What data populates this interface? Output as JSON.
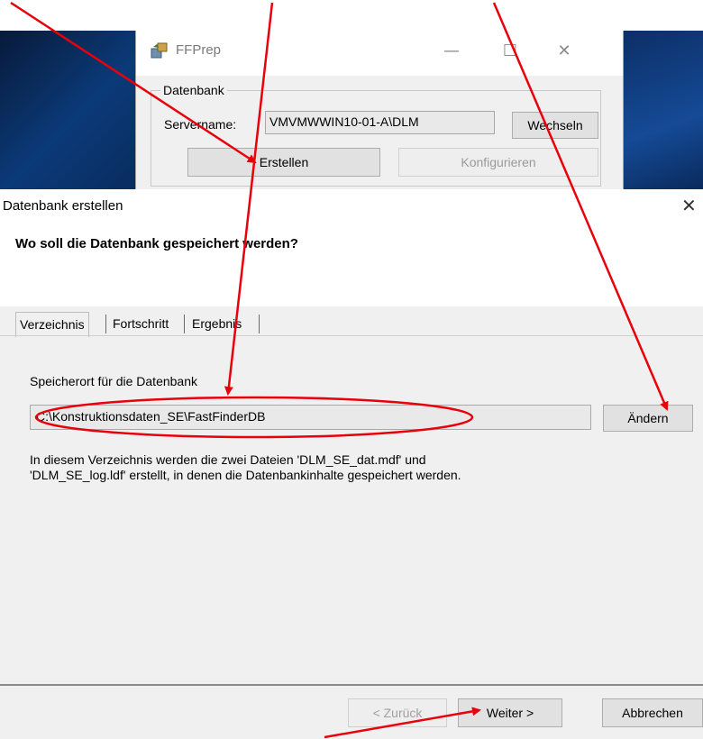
{
  "ffprep": {
    "title": "FFPrep",
    "minimize": "—",
    "maximize": "☐",
    "close": "✕",
    "group_label": "Datenbank",
    "servername_label": "Servername:",
    "servername_value": "VMVMWWIN10-01-A\\DLM",
    "wechseln_label": "Wechseln",
    "erstellen_label": "Erstellen",
    "konfigurieren_label": "Konfigurieren"
  },
  "wizard": {
    "title": "Datenbank erstellen",
    "close": "✕",
    "question": "Wo soll die Datenbank gespeichert werden?",
    "tabs": [
      {
        "label": "Verzeichnis"
      },
      {
        "label": "Fortschritt"
      },
      {
        "label": "Ergebnis"
      }
    ],
    "location_label": "Speicherort für die Datenbank",
    "path_value": "C:\\Konstruktionsdaten_SE\\FastFinderDB",
    "aendern_label": "Ändern",
    "info_line1": "In diesem Verzeichnis werden die zwei Dateien 'DLM_SE_dat.mdf' und",
    "info_line2": "'DLM_SE_log.ldf' erstellt, in denen die Datenbankinhalte gespeichert werden.",
    "zurueck_label": "< Zurück",
    "weiter_label": "Weiter >",
    "abbrechen_label": "Abbrechen"
  },
  "annotation_color": "#e8000b"
}
